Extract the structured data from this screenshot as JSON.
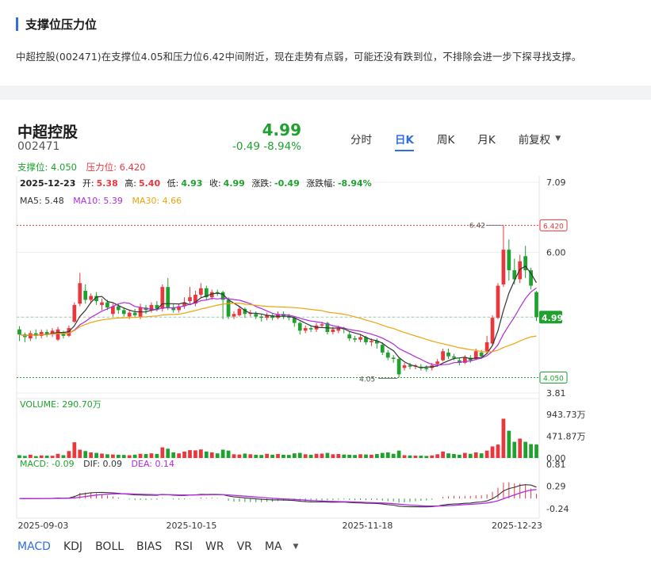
{
  "section": {
    "title": "支撑位压力位",
    "description": "中超控股(002471)在支撑位4.05和压力位6.42中间附近，现在走势有点弱，可能还没有跌到位，不排除会进一步下探寻找支撑。"
  },
  "stock": {
    "name": "中超控股",
    "code": "002471",
    "price": "4.99",
    "change": "-0.49 -8.94%"
  },
  "tabs": [
    "分时",
    "日K",
    "周K",
    "月K",
    "前复权"
  ],
  "active_tab": "日K",
  "support_label": "支撑位: 4.050",
  "resistance_label": "压力位: 6.420",
  "indicator_tabs": [
    "MACD",
    "KDJ",
    "BOLL",
    "BIAS",
    "RSI",
    "WR",
    "VR",
    "MA"
  ],
  "active_indicator": "MACD",
  "colors": {
    "up": "#e8383d",
    "down": "#1ea12f",
    "accent": "#2f6fe4",
    "ma5": "#333333",
    "ma10": "#b12adf",
    "ma30": "#f0a30a"
  },
  "chart_data": {
    "type": "candlestick",
    "info_line": {
      "date": "2025-12-23",
      "open_label": "开:",
      "open": "5.38",
      "high_label": "高:",
      "high": "5.40",
      "low_label": "低:",
      "low": "4.93",
      "close_label": "收:",
      "close": "4.99",
      "chg_label": "涨跌:",
      "chg": "-0.49",
      "pct_label": "涨跌幅:",
      "pct": "-8.94%"
    },
    "ma_legend": [
      {
        "label": "MA5: 5.48",
        "color": "#333333"
      },
      {
        "label": "MA10: 5.39",
        "color": "#b12adf"
      },
      {
        "label": "MA30: 4.66",
        "color": "#f0a30a"
      }
    ],
    "price_axis": [
      "7.09",
      "6.00",
      "3.81"
    ],
    "ylim": [
      3.81,
      7.09
    ],
    "resistance": {
      "value": 6.42,
      "label": "6.420",
      "marker": "6.42"
    },
    "support": {
      "value": 4.05,
      "label": "4.050",
      "marker": "4.05"
    },
    "current": {
      "value": 4.99,
      "label": "4.99"
    },
    "x_dates": [
      "2025-09-03",
      "2025-10-15",
      "2025-11-18",
      "2025-12-23"
    ],
    "ohlc": [
      [
        4.8,
        4.72,
        4.85,
        4.62
      ],
      [
        4.72,
        4.68,
        4.75,
        4.6
      ],
      [
        4.66,
        4.74,
        4.78,
        4.62
      ],
      [
        4.74,
        4.7,
        4.8,
        4.65
      ],
      [
        4.7,
        4.76,
        4.8,
        4.66
      ],
      [
        4.76,
        4.72,
        4.8,
        4.68
      ],
      [
        4.72,
        4.78,
        4.82,
        4.68
      ],
      [
        4.64,
        4.8,
        4.84,
        4.62
      ],
      [
        4.74,
        4.7,
        4.78,
        4.66
      ],
      [
        4.7,
        4.82,
        4.86,
        4.68
      ],
      [
        4.92,
        5.18,
        5.22,
        4.9
      ],
      [
        5.2,
        5.52,
        5.68,
        5.16
      ],
      [
        5.4,
        5.26,
        5.5,
        5.2
      ],
      [
        5.26,
        5.32,
        5.36,
        5.2
      ],
      [
        5.32,
        5.24,
        5.38,
        5.18
      ],
      [
        5.18,
        5.22,
        5.28,
        5.1
      ],
      [
        5.22,
        5.14,
        5.26,
        5.1
      ],
      [
        5.04,
        5.16,
        5.2,
        5.0
      ],
      [
        5.16,
        5.1,
        5.2,
        5.04
      ],
      [
        5.1,
        5.04,
        5.14,
        5.0
      ],
      [
        5.0,
        5.06,
        5.1,
        4.96
      ],
      [
        5.06,
        5.02,
        5.12,
        4.98
      ],
      [
        5.0,
        5.14,
        5.2,
        4.96
      ],
      [
        5.14,
        5.1,
        5.18,
        5.04
      ],
      [
        5.1,
        5.18,
        5.22,
        5.06
      ],
      [
        5.18,
        5.12,
        5.24,
        5.08
      ],
      [
        5.12,
        5.46,
        5.5,
        5.08
      ],
      [
        5.46,
        5.14,
        5.6,
        5.1
      ],
      [
        5.14,
        5.1,
        5.2,
        5.06
      ],
      [
        5.1,
        5.16,
        5.2,
        5.06
      ],
      [
        5.16,
        5.22,
        5.3,
        5.12
      ],
      [
        5.24,
        5.3,
        5.46,
        5.2
      ],
      [
        5.2,
        5.34,
        5.4,
        5.16
      ],
      [
        5.34,
        5.44,
        5.52,
        5.3
      ],
      [
        5.44,
        5.3,
        5.48,
        5.26
      ],
      [
        5.3,
        5.38,
        5.42,
        5.26
      ],
      [
        5.38,
        5.36,
        5.42,
        5.32
      ],
      [
        5.38,
        5.26,
        5.4,
        4.96
      ],
      [
        5.26,
        5.0,
        5.3,
        4.96
      ],
      [
        5.0,
        5.04,
        5.08,
        4.96
      ],
      [
        5.02,
        5.12,
        5.16,
        5.0
      ],
      [
        5.12,
        5.04,
        5.14,
        4.98
      ],
      [
        5.04,
        5.06,
        5.1,
        5.0
      ],
      [
        5.04,
        5.0,
        5.08,
        4.96
      ],
      [
        5.0,
        4.98,
        5.04,
        4.92
      ],
      [
        4.98,
        5.02,
        5.06,
        4.94
      ],
      [
        5.02,
        4.98,
        5.04,
        4.94
      ],
      [
        4.98,
        5.04,
        5.08,
        4.96
      ],
      [
        5.04,
        5.0,
        5.08,
        4.96
      ],
      [
        5.0,
        4.98,
        5.04,
        4.94
      ],
      [
        4.98,
        4.9,
        5.0,
        4.84
      ],
      [
        4.9,
        4.78,
        4.92,
        4.72
      ],
      [
        4.78,
        4.82,
        4.86,
        4.74
      ],
      [
        4.82,
        4.8,
        4.86,
        4.76
      ],
      [
        4.8,
        4.86,
        4.9,
        4.76
      ],
      [
        4.86,
        4.88,
        4.92,
        4.82
      ],
      [
        4.9,
        4.76,
        4.92,
        4.72
      ],
      [
        4.76,
        4.8,
        4.84,
        4.72
      ],
      [
        4.78,
        4.82,
        4.86,
        4.74
      ],
      [
        4.82,
        4.8,
        4.84,
        4.74
      ],
      [
        4.72,
        4.66,
        4.76,
        4.62
      ],
      [
        4.66,
        4.64,
        4.7,
        4.6
      ],
      [
        4.64,
        4.68,
        4.72,
        4.6
      ],
      [
        4.68,
        4.6,
        4.7,
        4.56
      ],
      [
        4.6,
        4.62,
        4.66,
        4.54
      ],
      [
        4.62,
        4.58,
        4.66,
        4.5
      ],
      [
        4.56,
        4.44,
        4.6,
        4.4
      ],
      [
        4.44,
        4.36,
        4.48,
        4.32
      ],
      [
        4.36,
        4.34,
        4.4,
        4.28
      ],
      [
        4.34,
        4.1,
        4.36,
        4.05
      ],
      [
        4.2,
        4.24,
        4.28,
        4.16
      ],
      [
        4.24,
        4.22,
        4.28,
        4.18
      ],
      [
        4.22,
        4.24,
        4.26,
        4.18
      ],
      [
        4.22,
        4.2,
        4.26,
        4.16
      ],
      [
        4.2,
        4.18,
        4.24,
        4.14
      ],
      [
        4.2,
        4.24,
        4.28,
        4.16
      ],
      [
        4.26,
        4.3,
        4.34,
        4.22
      ],
      [
        4.32,
        4.46,
        4.5,
        4.3
      ],
      [
        4.44,
        4.38,
        4.5,
        4.34
      ],
      [
        4.38,
        4.36,
        4.42,
        4.32
      ],
      [
        4.32,
        4.28,
        4.36,
        4.24
      ],
      [
        4.28,
        4.36,
        4.4,
        4.26
      ],
      [
        4.36,
        4.32,
        4.4,
        4.28
      ],
      [
        4.34,
        4.46,
        4.5,
        4.32
      ],
      [
        4.44,
        4.38,
        4.48,
        4.34
      ],
      [
        4.46,
        4.6,
        4.7,
        4.42
      ],
      [
        4.58,
        4.98,
        5.02,
        4.56
      ],
      [
        4.98,
        5.48,
        5.52,
        4.96
      ],
      [
        5.5,
        6.04,
        6.42,
        5.46
      ],
      [
        6.04,
        5.72,
        6.2,
        5.56
      ],
      [
        5.72,
        5.58,
        5.9,
        5.5
      ],
      [
        5.58,
        5.86,
        5.96,
        5.52
      ],
      [
        5.94,
        5.72,
        6.1,
        5.6
      ],
      [
        5.72,
        5.48,
        5.76,
        5.42
      ],
      [
        5.38,
        4.99,
        5.4,
        4.93
      ]
    ],
    "volume": {
      "label": "VOLUME: 290.70万",
      "axis": [
        "943.73万",
        "471.87万",
        "0.00"
      ],
      "ylim": [
        0,
        943.73
      ],
      "values": [
        60,
        45,
        70,
        40,
        55,
        50,
        48,
        90,
        60,
        150,
        340,
        180,
        150,
        120,
        110,
        95,
        80,
        75,
        70,
        65,
        60,
        72,
        90,
        85,
        100,
        88,
        230,
        200,
        120,
        100,
        140,
        170,
        165,
        185,
        140,
        120,
        100,
        180,
        160,
        80,
        75,
        95,
        80,
        70,
        65,
        90,
        70,
        85,
        70,
        65,
        100,
        110,
        80,
        70,
        90,
        95,
        110,
        80,
        85,
        75,
        70,
        65,
        80,
        75,
        70,
        85,
        110,
        120,
        90,
        160,
        60,
        55,
        50,
        50,
        45,
        55,
        80,
        140,
        100,
        85,
        70,
        110,
        90,
        120,
        100,
        160,
        250,
        290,
        850,
        590,
        350,
        420,
        350,
        300,
        290.7
      ]
    },
    "macd": {
      "label": "MACD: -0.09",
      "dif_label": "DIF: 0.09",
      "dea_label": "DEA: 0.14",
      "axis": [
        "0.81",
        "0.29",
        "-0.24"
      ],
      "ylim": [
        -0.24,
        0.81
      ]
    }
  }
}
